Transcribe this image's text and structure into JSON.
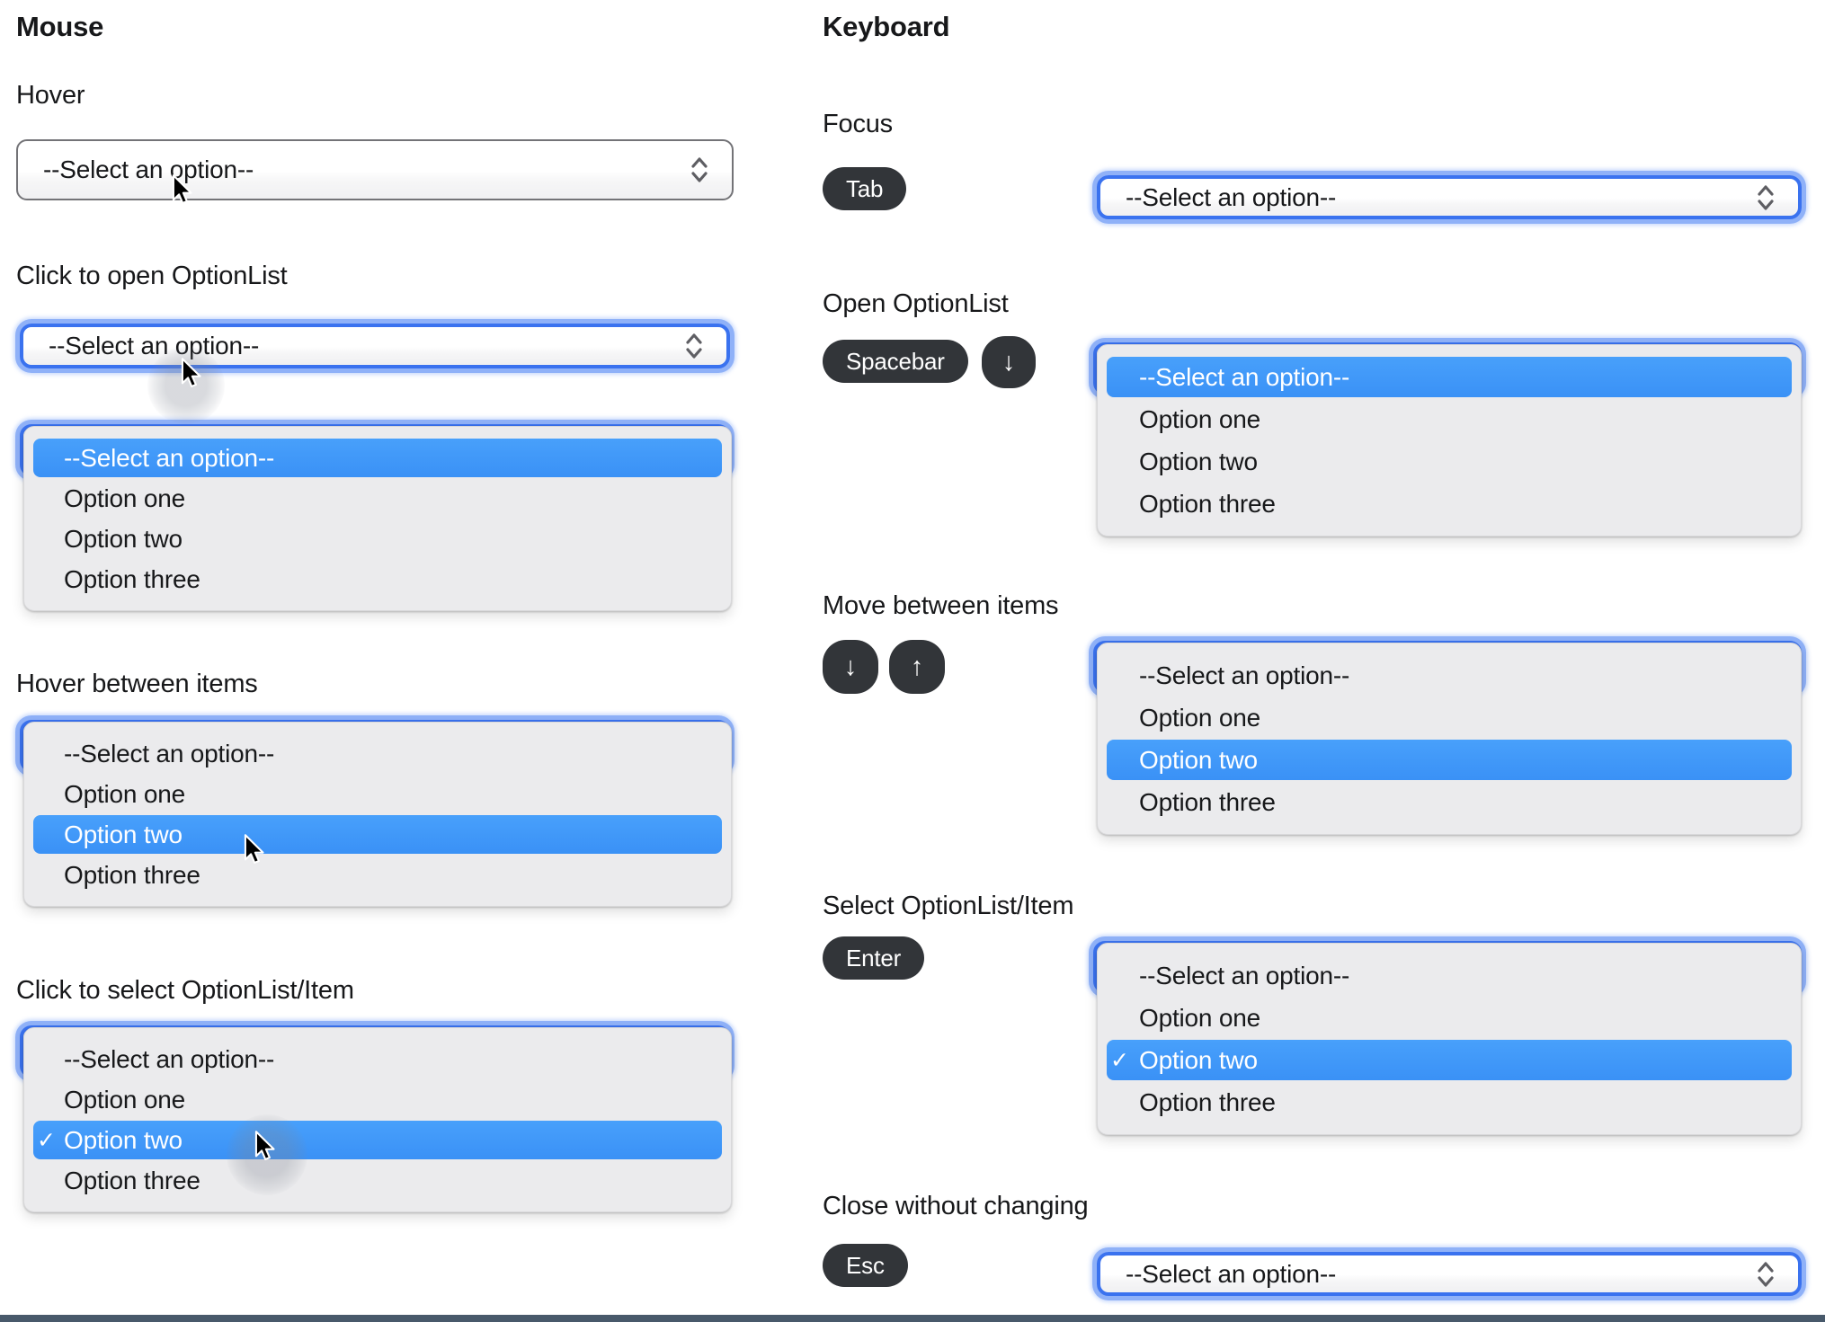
{
  "colors": {
    "accent_blue": "#3f97f8",
    "focus_ring_inner": "#3a72ef",
    "focus_ring_outer": "#8fb1f8",
    "key_badge_bg": "#323539",
    "panel_bg": "#ebebed",
    "text": "#17181a",
    "select_border": "#737377",
    "bottom_line": "#48596b"
  },
  "mouse": {
    "title": "Mouse",
    "hover_label": "Hover",
    "click_open_label": "Click to open OptionList",
    "hover_items_label": "Hover between items",
    "click_select_label": "Click to select OptionList/Item"
  },
  "keyboard": {
    "title": "Keyboard",
    "focus_label": "Focus",
    "open_label": "Open OptionList",
    "move_label": "Move between items",
    "select_label": "Select OptionList/Item",
    "close_label": "Close without changing"
  },
  "keys": {
    "tab": "Tab",
    "spacebar": "Spacebar",
    "enter": "Enter",
    "esc": "Esc",
    "arrow_down": "↓",
    "arrow_up": "↑"
  },
  "select": {
    "placeholder": "--Select an option--",
    "options": [
      "--Select an option--",
      "Option one",
      "Option two",
      "Option three"
    ]
  },
  "icons": {
    "checkmark": "✓"
  }
}
